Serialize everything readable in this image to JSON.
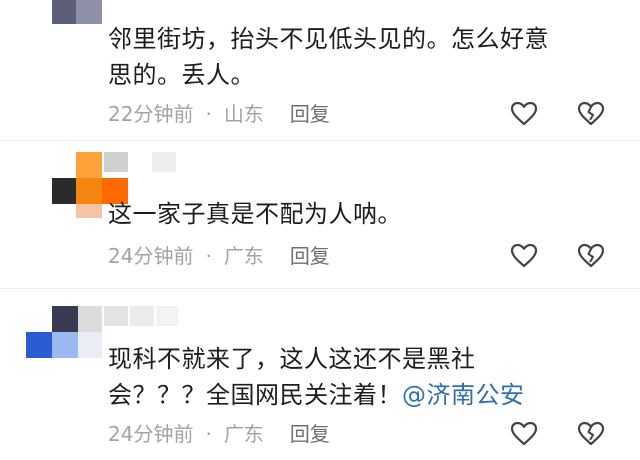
{
  "comments": [
    {
      "text_line1": "邻里街坊，抬头不见低头见的。怎么好意",
      "text_line2": "思的。丢人。",
      "time": "22分钟前",
      "separator": "·",
      "location": "山东",
      "reply_label": "回复",
      "like_icon": "heart-outline-icon",
      "dislike_icon": "broken-heart-icon"
    },
    {
      "text_line1": "这一家子真是不配为人呐。",
      "time": "24分钟前",
      "separator": "·",
      "location": "广东",
      "reply_label": "回复",
      "like_icon": "heart-outline-icon",
      "dislike_icon": "broken-heart-icon"
    },
    {
      "text_line1": "现科不就来了，这人这还不是黑社",
      "text_line2": "会？？？全国网民关注着！",
      "mention": "@济南公安",
      "time": "24分钟前",
      "separator": "·",
      "location": "广东",
      "reply_label": "回复",
      "like_icon": "heart-outline-icon",
      "dislike_icon": "broken-heart-icon"
    }
  ],
  "colors": {
    "text": "#1d1d1d",
    "meta": "#a3a3a3",
    "reply": "#6f6f6f",
    "mention": "#2f6db5",
    "icon": "#444444"
  }
}
